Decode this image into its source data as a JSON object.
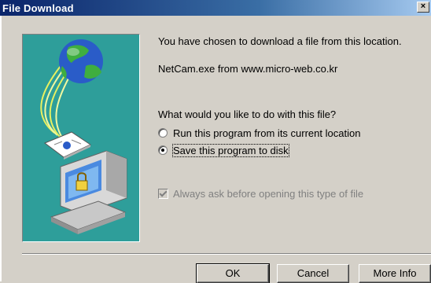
{
  "window": {
    "title": "File Download",
    "close_label": "×"
  },
  "message": {
    "line1": "You have chosen to download a file from this location.",
    "source": "NetCam.exe from www.micro-web.co.kr"
  },
  "question": "What would you like to do with this file?",
  "options": [
    {
      "label": "Run this program from its current location",
      "selected": false
    },
    {
      "label": "Save this program to disk",
      "selected": true
    }
  ],
  "always_ask": {
    "label": "Always ask before opening this type of file",
    "checked": true,
    "enabled": false
  },
  "buttons": {
    "ok": "OK",
    "cancel": "Cancel",
    "more_info": "More Info"
  },
  "icons": {
    "illustration": "globe-to-computer-download-icon",
    "close": "close-icon"
  },
  "colors": {
    "title_bar": "#0a246a",
    "dialog_bg": "#d4d0c8",
    "illustration_bg": "#2e9e9a"
  }
}
